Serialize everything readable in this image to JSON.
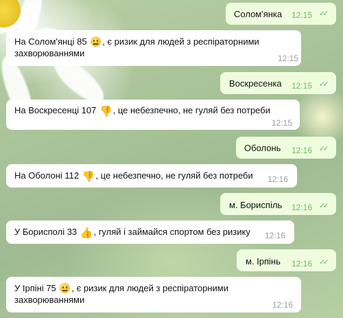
{
  "messages": [
    {
      "type": "out",
      "text": "Солом'янка",
      "time": "12:15"
    },
    {
      "type": "in",
      "line1_pre": "На Солом'янці 85",
      "line1_post": ", є ризик для людей з респіраторними",
      "line2": "захворюваннями",
      "time": "12:15",
      "emoji": "neutral-face"
    },
    {
      "type": "out",
      "text": "Воскресенка",
      "time": "12:15"
    },
    {
      "type": "in",
      "line1_pre": "На Воскресенці 107",
      "line1_post": ", це небезпечно, не гуляй без потреби",
      "time": "12:15",
      "emoji": "thumbs-down"
    },
    {
      "type": "out",
      "text": "Оболонь",
      "time": "12:16"
    },
    {
      "type": "in",
      "line1_pre": "На Оболоні 112",
      "line1_post": ", це небезпечно, не гуляй без потреби",
      "time": "12:16",
      "emoji": "thumbs-down"
    },
    {
      "type": "out",
      "text": "м. Бориспіль",
      "time": "12:16"
    },
    {
      "type": "in",
      "line1_pre": "У Борисполі 33",
      "line1_post": ", гуляй і займайся спортом без ризику",
      "time": "12:16",
      "emoji": "thumbs-up"
    },
    {
      "type": "out",
      "text": "м. Ірпінь",
      "time": "12:16"
    },
    {
      "type": "in",
      "line1_pre": "У Ірпіні 75",
      "line1_post": ", є ризик для людей з респіраторними",
      "line2": "захворюваннями",
      "time": "12:16",
      "emoji": "neutral-face"
    }
  ],
  "colors": {
    "incoming": "#ffffff",
    "outgoing": "#effdde",
    "check": "#6cb865",
    "time": "#9aa0a6"
  }
}
